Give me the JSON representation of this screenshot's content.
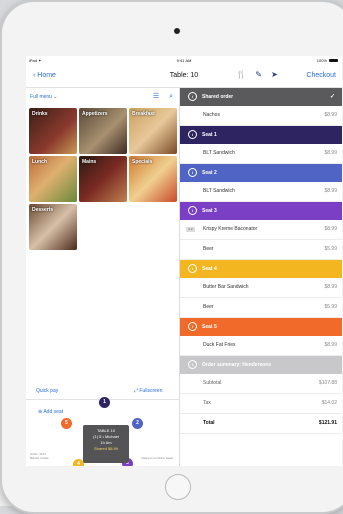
{
  "status": {
    "carrier": "iPad ✦",
    "time": "9:41 AM",
    "battery": "100%"
  },
  "nav": {
    "back_label": "Home",
    "title": "Table: 10",
    "checkout_label": "Checkout"
  },
  "menu": {
    "header": "Full menu ⌄",
    "tiles": [
      "Drinks",
      "Appetizers",
      "Breakfast",
      "Lunch",
      "Mains",
      "Specials",
      "Desserts"
    ]
  },
  "actions": {
    "quick_pay": "Quick pay",
    "fullscreen": "Fullscreen",
    "add_seat": "Add seat"
  },
  "table": {
    "seats": [
      "1",
      "2",
      "3",
      "4",
      "5"
    ],
    "title": "TABLE 10",
    "guest_line1": "(1) 5 • Michael",
    "guest_line2": "1h 6m",
    "shared": "Shared $8.99"
  },
  "footer": {
    "left1": "Order: 2101",
    "left2": "Bartsd: trustle",
    "right": "Swipe to combine seats"
  },
  "order": {
    "shared_header": "Shared order",
    "shared_items": [
      {
        "name": "Nachos",
        "price": "$8.99"
      }
    ],
    "seats": [
      {
        "label": "Seat 1",
        "color": "#3b2a7a",
        "items": [
          {
            "name": "BLT Sandwich",
            "price": "$8.99"
          }
        ]
      },
      {
        "label": "Seat 2",
        "color": "#4f64c4",
        "items": [
          {
            "name": "BLT Sandwich",
            "price": "$8.99"
          }
        ]
      },
      {
        "label": "Seat 3",
        "color": "#7a3fc4",
        "items": [
          {
            "name": "Krispy Kreme Baconator",
            "price": "$8.99",
            "badge": "2.2"
          },
          {
            "name": "Beer",
            "price": "$5.99"
          }
        ]
      },
      {
        "label": "Seat 4",
        "color": "#f4b620",
        "items": [
          {
            "name": "Butter Bar Sandwich",
            "price": "$8.99"
          },
          {
            "name": "Beer",
            "price": "$5.99"
          }
        ]
      },
      {
        "label": "Seat 5",
        "color": "#f26a2a",
        "items": [
          {
            "name": "Duck Fat Fries",
            "price": "$8.99"
          }
        ]
      }
    ],
    "summary_header": "Order summary: Hendersons",
    "subtotal": {
      "label": "Subtotal",
      "value": "$107.88"
    },
    "tax": {
      "label": "Tax",
      "value": "$14.02"
    },
    "total": {
      "label": "Total",
      "value": "$121.91"
    }
  },
  "colors": {
    "accent": "#2a6fdb",
    "header_dark": "#5a5a5d",
    "summary_gray": "#c8c8ca"
  }
}
